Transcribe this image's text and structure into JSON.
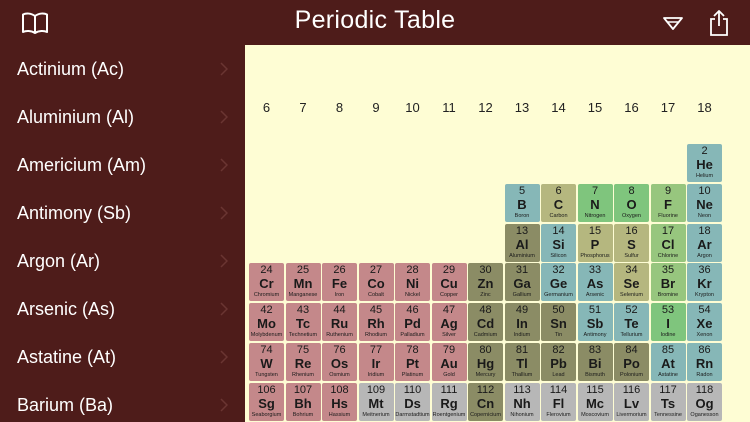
{
  "header": {
    "title": "Periodic Table",
    "icons": {
      "left": "book-icon",
      "filter": "filter-icon",
      "share": "share-icon"
    }
  },
  "sidebar": {
    "items": [
      {
        "label": "Actinium (Ac)"
      },
      {
        "label": "Aluminium (Al)"
      },
      {
        "label": "Americium (Am)"
      },
      {
        "label": "Antimony (Sb)"
      },
      {
        "label": "Argon (Ar)"
      },
      {
        "label": "Arsenic (As)"
      },
      {
        "label": "Astatine (At)"
      },
      {
        "label": "Barium (Ba)"
      }
    ]
  },
  "table": {
    "groups": [
      "6",
      "7",
      "8",
      "9",
      "10",
      "11",
      "12",
      "13",
      "14",
      "15",
      "16",
      "17",
      "18"
    ],
    "categories": {
      "transition": "#c4888a",
      "post_transition": "#8b8c65",
      "metalloid": "#b5b77f",
      "nonmetal": "#7fc57d",
      "halogen": "#97c67e",
      "noble_gas": "#86b7b7",
      "superheavy": "#b7b7b7"
    },
    "elements": [
      {
        "num": "2",
        "sym": "He",
        "name": "Helium",
        "group": 18,
        "row": 0,
        "cat": "noble_gas"
      },
      {
        "num": "5",
        "sym": "B",
        "name": "Boron",
        "group": 13,
        "row": 1,
        "cat": "noble_gas"
      },
      {
        "num": "6",
        "sym": "C",
        "name": "Carbon",
        "group": 14,
        "row": 1,
        "cat": "metalloid"
      },
      {
        "num": "7",
        "sym": "N",
        "name": "Nitrogen",
        "group": 15,
        "row": 1,
        "cat": "nonmetal"
      },
      {
        "num": "8",
        "sym": "O",
        "name": "Oxygen",
        "group": 16,
        "row": 1,
        "cat": "nonmetal"
      },
      {
        "num": "9",
        "sym": "F",
        "name": "Fluorine",
        "group": 17,
        "row": 1,
        "cat": "halogen"
      },
      {
        "num": "10",
        "sym": "Ne",
        "name": "Neon",
        "group": 18,
        "row": 1,
        "cat": "noble_gas"
      },
      {
        "num": "13",
        "sym": "Al",
        "name": "Aluminium",
        "group": 13,
        "row": 2,
        "cat": "post_transition"
      },
      {
        "num": "14",
        "sym": "Si",
        "name": "Silicon",
        "group": 14,
        "row": 2,
        "cat": "noble_gas"
      },
      {
        "num": "15",
        "sym": "P",
        "name": "Phosphorus",
        "group": 15,
        "row": 2,
        "cat": "metalloid"
      },
      {
        "num": "16",
        "sym": "S",
        "name": "Sulfur",
        "group": 16,
        "row": 2,
        "cat": "metalloid"
      },
      {
        "num": "17",
        "sym": "Cl",
        "name": "Chlorine",
        "group": 17,
        "row": 2,
        "cat": "halogen"
      },
      {
        "num": "18",
        "sym": "Ar",
        "name": "Argon",
        "group": 18,
        "row": 2,
        "cat": "noble_gas"
      },
      {
        "num": "24",
        "sym": "Cr",
        "name": "Chromium",
        "group": 6,
        "row": 3,
        "cat": "transition"
      },
      {
        "num": "25",
        "sym": "Mn",
        "name": "Manganese",
        "group": 7,
        "row": 3,
        "cat": "transition"
      },
      {
        "num": "26",
        "sym": "Fe",
        "name": "Iron",
        "group": 8,
        "row": 3,
        "cat": "transition"
      },
      {
        "num": "27",
        "sym": "Co",
        "name": "Cobalt",
        "group": 9,
        "row": 3,
        "cat": "transition"
      },
      {
        "num": "28",
        "sym": "Ni",
        "name": "Nickel",
        "group": 10,
        "row": 3,
        "cat": "transition"
      },
      {
        "num": "29",
        "sym": "Cu",
        "name": "Copper",
        "group": 11,
        "row": 3,
        "cat": "transition"
      },
      {
        "num": "30",
        "sym": "Zn",
        "name": "Zinc",
        "group": 12,
        "row": 3,
        "cat": "post_transition"
      },
      {
        "num": "31",
        "sym": "Ga",
        "name": "Gallium",
        "group": 13,
        "row": 3,
        "cat": "post_transition"
      },
      {
        "num": "32",
        "sym": "Ge",
        "name": "Germanium",
        "group": 14,
        "row": 3,
        "cat": "noble_gas"
      },
      {
        "num": "33",
        "sym": "As",
        "name": "Arsenic",
        "group": 15,
        "row": 3,
        "cat": "noble_gas"
      },
      {
        "num": "34",
        "sym": "Se",
        "name": "Selenium",
        "group": 16,
        "row": 3,
        "cat": "metalloid"
      },
      {
        "num": "35",
        "sym": "Br",
        "name": "Bromine",
        "group": 17,
        "row": 3,
        "cat": "halogen"
      },
      {
        "num": "36",
        "sym": "Kr",
        "name": "Krypton",
        "group": 18,
        "row": 3,
        "cat": "noble_gas"
      },
      {
        "num": "42",
        "sym": "Mo",
        "name": "Molybdenum",
        "group": 6,
        "row": 4,
        "cat": "transition"
      },
      {
        "num": "43",
        "sym": "Tc",
        "name": "Technetium",
        "group": 7,
        "row": 4,
        "cat": "transition"
      },
      {
        "num": "44",
        "sym": "Ru",
        "name": "Ruthenium",
        "group": 8,
        "row": 4,
        "cat": "transition"
      },
      {
        "num": "45",
        "sym": "Rh",
        "name": "Rhodium",
        "group": 9,
        "row": 4,
        "cat": "transition"
      },
      {
        "num": "46",
        "sym": "Pd",
        "name": "Palladium",
        "group": 10,
        "row": 4,
        "cat": "transition"
      },
      {
        "num": "47",
        "sym": "Ag",
        "name": "Silver",
        "group": 11,
        "row": 4,
        "cat": "transition"
      },
      {
        "num": "48",
        "sym": "Cd",
        "name": "Cadmium",
        "group": 12,
        "row": 4,
        "cat": "post_transition"
      },
      {
        "num": "49",
        "sym": "In",
        "name": "Indium",
        "group": 13,
        "row": 4,
        "cat": "post_transition"
      },
      {
        "num": "50",
        "sym": "Sn",
        "name": "Tin",
        "group": 14,
        "row": 4,
        "cat": "post_transition"
      },
      {
        "num": "51",
        "sym": "Sb",
        "name": "Antimony",
        "group": 15,
        "row": 4,
        "cat": "noble_gas"
      },
      {
        "num": "52",
        "sym": "Te",
        "name": "Tellurium",
        "group": 16,
        "row": 4,
        "cat": "noble_gas"
      },
      {
        "num": "53",
        "sym": "I",
        "name": "Iodine",
        "group": 17,
        "row": 4,
        "cat": "nonmetal"
      },
      {
        "num": "54",
        "sym": "Xe",
        "name": "Xenon",
        "group": 18,
        "row": 4,
        "cat": "noble_gas"
      },
      {
        "num": "74",
        "sym": "W",
        "name": "Tungsten",
        "group": 6,
        "row": 5,
        "cat": "transition"
      },
      {
        "num": "75",
        "sym": "Re",
        "name": "Rhenium",
        "group": 7,
        "row": 5,
        "cat": "transition"
      },
      {
        "num": "76",
        "sym": "Os",
        "name": "Osmium",
        "group": 8,
        "row": 5,
        "cat": "transition"
      },
      {
        "num": "77",
        "sym": "Ir",
        "name": "Iridium",
        "group": 9,
        "row": 5,
        "cat": "transition"
      },
      {
        "num": "78",
        "sym": "Pt",
        "name": "Platinum",
        "group": 10,
        "row": 5,
        "cat": "transition"
      },
      {
        "num": "79",
        "sym": "Au",
        "name": "Gold",
        "group": 11,
        "row": 5,
        "cat": "transition"
      },
      {
        "num": "80",
        "sym": "Hg",
        "name": "Mercury",
        "group": 12,
        "row": 5,
        "cat": "post_transition"
      },
      {
        "num": "81",
        "sym": "Tl",
        "name": "Thallium",
        "group": 13,
        "row": 5,
        "cat": "post_transition"
      },
      {
        "num": "82",
        "sym": "Pb",
        "name": "Lead",
        "group": 14,
        "row": 5,
        "cat": "post_transition"
      },
      {
        "num": "83",
        "sym": "Bi",
        "name": "Bismuth",
        "group": 15,
        "row": 5,
        "cat": "post_transition"
      },
      {
        "num": "84",
        "sym": "Po",
        "name": "Polonium",
        "group": 16,
        "row": 5,
        "cat": "post_transition"
      },
      {
        "num": "85",
        "sym": "At",
        "name": "Astatine",
        "group": 17,
        "row": 5,
        "cat": "noble_gas"
      },
      {
        "num": "86",
        "sym": "Rn",
        "name": "Radon",
        "group": 18,
        "row": 5,
        "cat": "noble_gas"
      },
      {
        "num": "106",
        "sym": "Sg",
        "name": "Seaborgium",
        "group": 6,
        "row": 6,
        "cat": "transition"
      },
      {
        "num": "107",
        "sym": "Bh",
        "name": "Bohrium",
        "group": 7,
        "row": 6,
        "cat": "transition"
      },
      {
        "num": "108",
        "sym": "Hs",
        "name": "Hassium",
        "group": 8,
        "row": 6,
        "cat": "transition"
      },
      {
        "num": "109",
        "sym": "Mt",
        "name": "Meitnerium",
        "group": 9,
        "row": 6,
        "cat": "superheavy"
      },
      {
        "num": "110",
        "sym": "Ds",
        "name": "Darmstadtium",
        "group": 10,
        "row": 6,
        "cat": "superheavy"
      },
      {
        "num": "111",
        "sym": "Rg",
        "name": "Roentgenium",
        "group": 11,
        "row": 6,
        "cat": "superheavy"
      },
      {
        "num": "112",
        "sym": "Cn",
        "name": "Copernicium",
        "group": 12,
        "row": 6,
        "cat": "post_transition"
      },
      {
        "num": "113",
        "sym": "Nh",
        "name": "Nihonium",
        "group": 13,
        "row": 6,
        "cat": "superheavy"
      },
      {
        "num": "114",
        "sym": "Fl",
        "name": "Flerovium",
        "group": 14,
        "row": 6,
        "cat": "superheavy"
      },
      {
        "num": "115",
        "sym": "Mc",
        "name": "Moscovium",
        "group": 15,
        "row": 6,
        "cat": "superheavy"
      },
      {
        "num": "116",
        "sym": "Lv",
        "name": "Livermorium",
        "group": 16,
        "row": 6,
        "cat": "superheavy"
      },
      {
        "num": "117",
        "sym": "Ts",
        "name": "Tennessine",
        "group": 17,
        "row": 6,
        "cat": "superheavy"
      },
      {
        "num": "118",
        "sym": "Og",
        "name": "Oganesson",
        "group": 18,
        "row": 6,
        "cat": "superheavy"
      }
    ]
  }
}
